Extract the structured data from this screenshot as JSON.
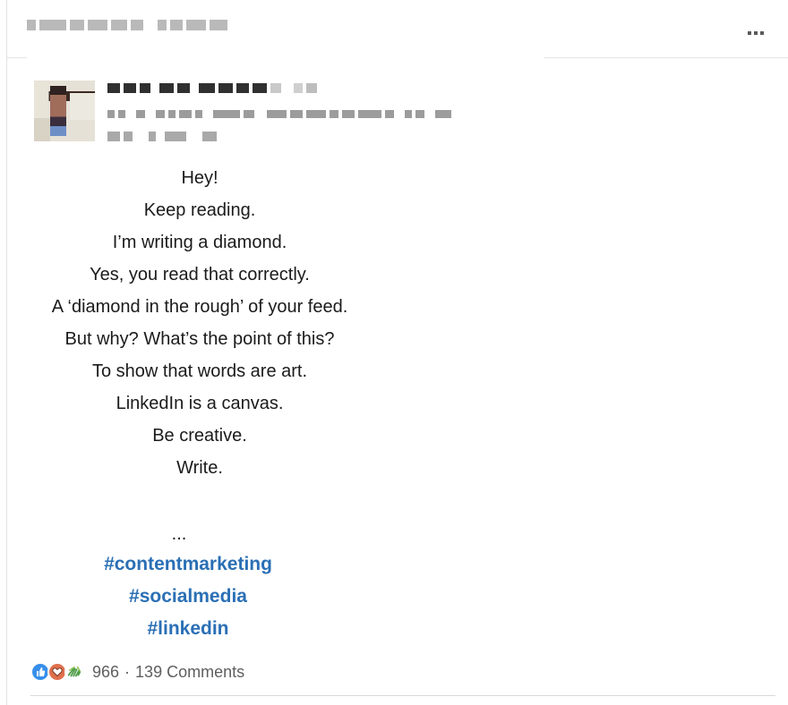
{
  "post": {
    "lines": [
      "Hey!",
      "Keep reading.",
      "I’m writing a diamond.",
      "Yes, you read that correctly.",
      "A ‘diamond in the rough’ of your feed.",
      "But why? What’s the point of this?",
      "To show that words are art.",
      "LinkedIn is a canvas.",
      "Be creative.",
      "Write."
    ],
    "ellipsis": "...",
    "hashtags": [
      "#contentmarketing",
      "#socialmedia",
      "#linkedin"
    ]
  },
  "social": {
    "reaction_count": "966",
    "separator": "·",
    "comments_label": "139 Comments",
    "reaction_icons": [
      "like-icon",
      "love-icon",
      "support-icon"
    ]
  },
  "colors": {
    "hashtag": "#2a6fb5",
    "like": "#378fe9",
    "love": "#df704d",
    "support": "#4f9d4a"
  }
}
